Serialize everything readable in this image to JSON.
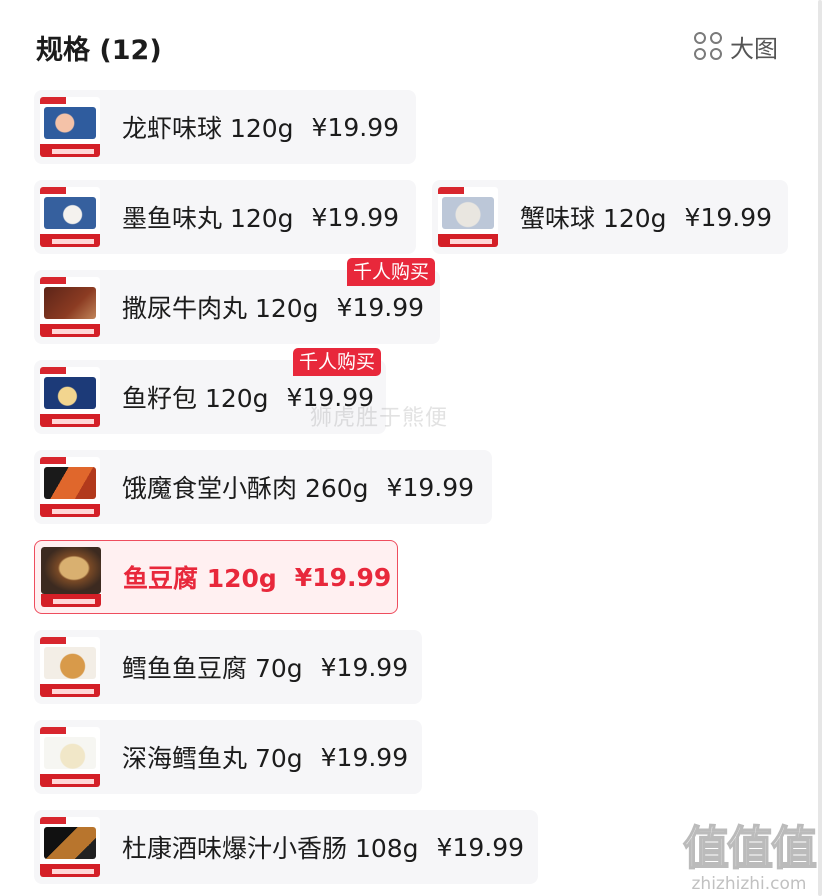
{
  "header": {
    "title": "规格 (12)",
    "view_toggle_label": "大图",
    "view_toggle_icon": "grid-icon"
  },
  "specs": [
    {
      "name": "龙虾味球 120g",
      "price": "¥19.99",
      "selected": false,
      "badge": ""
    },
    {
      "name": "墨鱼味丸 120g",
      "price": "¥19.99",
      "selected": false,
      "badge": ""
    },
    {
      "name": "蟹味球 120g",
      "price": "¥19.99",
      "selected": false,
      "badge": ""
    },
    {
      "name": "撒尿牛肉丸 120g",
      "price": "¥19.99",
      "selected": false,
      "badge": "千人购买"
    },
    {
      "name": "鱼籽包 120g",
      "price": "¥19.99",
      "selected": false,
      "badge": "千人购买"
    },
    {
      "name": "饿魔食堂小酥肉 260g",
      "price": "¥19.99",
      "selected": false,
      "badge": ""
    },
    {
      "name": "鱼豆腐 120g",
      "price": "¥19.99",
      "selected": true,
      "badge": ""
    },
    {
      "name": "鳕鱼鱼豆腐 70g",
      "price": "¥19.99",
      "selected": false,
      "badge": ""
    },
    {
      "name": "深海鳕鱼丸 70g",
      "price": "¥19.99",
      "selected": false,
      "badge": ""
    },
    {
      "name": "杜康酒味爆汁小香肠 108g",
      "price": "¥19.99",
      "selected": false,
      "badge": ""
    }
  ],
  "watermark": {
    "text": "狮虎胜于熊便",
    "brand": "值值值",
    "url": "zhizhizhi.com"
  },
  "colors": {
    "accent": "#e8283b",
    "selected_bg": "#fff0f1",
    "chip_bg": "#f6f6f8"
  }
}
